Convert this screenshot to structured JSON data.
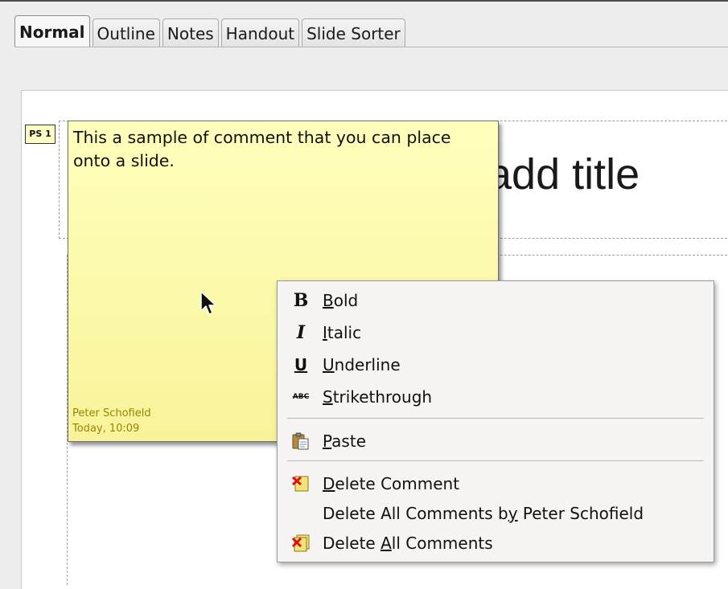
{
  "view_tabs": [
    {
      "label": "Normal",
      "active": true
    },
    {
      "label": "Outline",
      "active": false
    },
    {
      "label": "Notes",
      "active": false
    },
    {
      "label": "Handout",
      "active": false
    },
    {
      "label": "Slide Sorter",
      "active": false
    }
  ],
  "slide": {
    "title_placeholder": "add title"
  },
  "comment": {
    "marker": "PS 1",
    "text": "This a sample of comment that you can place onto a slide.",
    "author": "Peter Schofield",
    "date": "Today, 10:09",
    "color": "#ffffbc"
  },
  "context_menu": {
    "items": [
      {
        "label": "Bold",
        "icon": "bold-icon",
        "mnemonic": "B"
      },
      {
        "label": "Italic",
        "icon": "italic-icon",
        "mnemonic": "I"
      },
      {
        "label": "Underline",
        "icon": "underline-icon",
        "mnemonic": "U"
      },
      {
        "label": "Strikethrough",
        "icon": "strikethrough-icon",
        "mnemonic": "S"
      },
      {
        "label": "Paste",
        "icon": "paste-icon",
        "mnemonic": "P"
      },
      {
        "label": "Delete Comment",
        "icon": "delete-comment-icon",
        "mnemonic": "D"
      },
      {
        "label": "Delete All Comments by Peter Schofield",
        "icon": "",
        "mnemonic": "y"
      },
      {
        "label": "Delete All Comments",
        "icon": "delete-all-comments-icon",
        "mnemonic": "A"
      }
    ]
  }
}
